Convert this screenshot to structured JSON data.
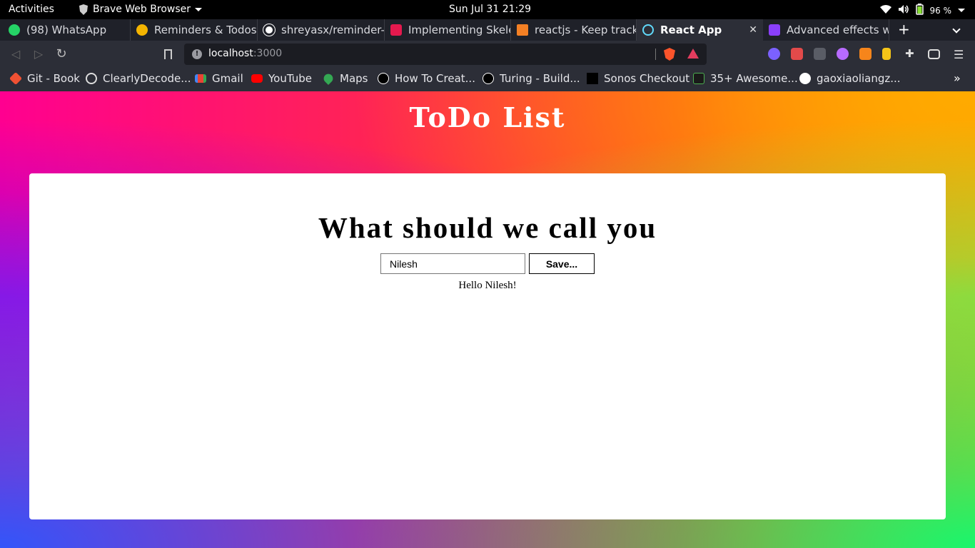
{
  "system_bar": {
    "activities": "Activities",
    "app_name": "Brave Web Browser",
    "clock": "Sun Jul 31  21:29",
    "battery": "96 %"
  },
  "tabs": [
    {
      "title": "(98) WhatsApp",
      "favicon": "whatsapp-icon",
      "badge": "98",
      "color": "#25d366"
    },
    {
      "title": "Reminders & Todos",
      "favicon": "reminders-icon",
      "color": "#f4b400"
    },
    {
      "title": "shreyasx/reminder-f",
      "favicon": "github-icon",
      "color": "#ffffff"
    },
    {
      "title": "Implementing Skelet",
      "favicon": "scrimba-icon",
      "color": "#e5194e"
    },
    {
      "title": "reactjs - Keep track o",
      "favicon": "stackoverflow-icon",
      "color": "#f48024"
    },
    {
      "title": "React App",
      "favicon": "react-icon",
      "color": "#61dafb",
      "active": true
    },
    {
      "title": "Advanced effects wi",
      "favicon": "app-icon",
      "color": "#8a3ffc"
    }
  ],
  "toolbar": {
    "url_host": "localhost",
    "url_port": ":3000"
  },
  "bookmarks": [
    {
      "label": "Git - Book",
      "icon": "git-icon",
      "color": "#f05133"
    },
    {
      "label": "ClearlyDecode...",
      "icon": "globe-icon",
      "color": "#dddddd"
    },
    {
      "label": "Gmail",
      "icon": "gmail-icon",
      "color": "#ea4335"
    },
    {
      "label": "YouTube",
      "icon": "youtube-icon",
      "color": "#ff0000"
    },
    {
      "label": "Maps",
      "icon": "maps-icon",
      "color": "#34a853"
    },
    {
      "label": "How To Creat...",
      "icon": "medium-icon",
      "color": "#000000"
    },
    {
      "label": "Turing - Build...",
      "icon": "turing-icon",
      "color": "#000000"
    },
    {
      "label": "Sonos Checkout",
      "icon": "sonos-icon",
      "color": "#000000"
    },
    {
      "label": "35+ Awesome...",
      "icon": "nd-icon",
      "color": "#1a1a1a"
    },
    {
      "label": "gaoxiaoliangz...",
      "icon": "github-icon",
      "color": "#ffffff"
    }
  ],
  "app": {
    "title": "ToDo List",
    "heading": "What should we call you",
    "name_value": "Nilesh",
    "save_label": "Save...",
    "greeting": "Hello Nilesh!"
  }
}
